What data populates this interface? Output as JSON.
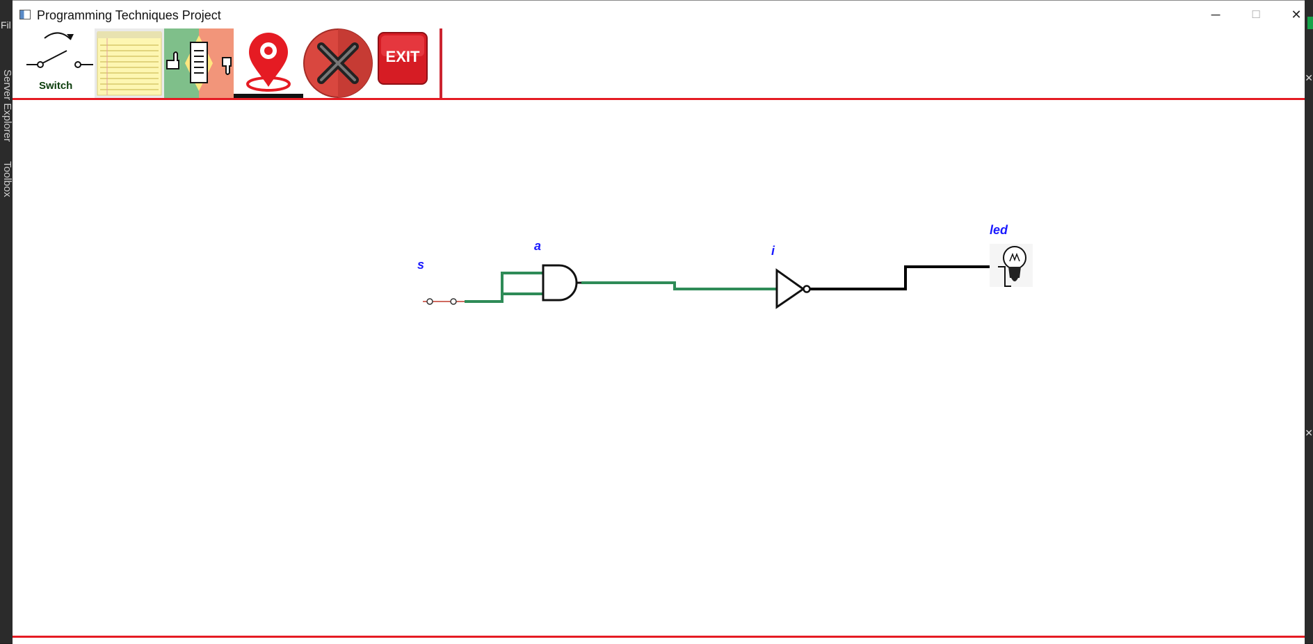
{
  "ide": {
    "menu_fragment": "Fil",
    "side_tabs": [
      "Server Explorer",
      "Toolbox"
    ]
  },
  "window": {
    "title": "Programming Techniques Project",
    "controls": {
      "minimize": "─",
      "maximize": "☐",
      "close": "✕"
    }
  },
  "toolbar": {
    "switch_label": "Switch",
    "exit_label": "EXIT",
    "tools": [
      "switch-tool",
      "notes-tool",
      "edit-tool",
      "location-tool",
      "delete-tool",
      "exit-tool"
    ]
  },
  "circuit": {
    "labels": {
      "switch": "s",
      "and_gate": "a",
      "not_gate": "i",
      "led": "led"
    },
    "wire_colors": {
      "active": "#2e8b57",
      "inactive": "#000000"
    }
  },
  "colors": {
    "accent_red": "#e51b23",
    "label_blue": "#1a1aff"
  }
}
